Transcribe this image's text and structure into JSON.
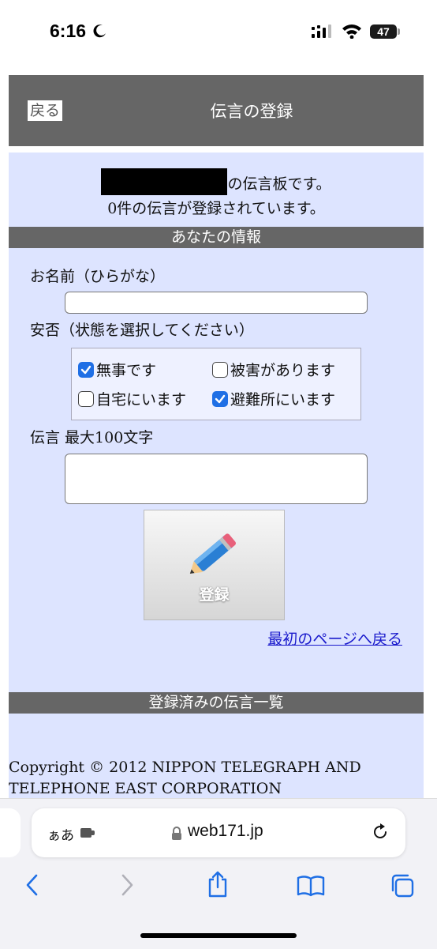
{
  "status": {
    "time": "6:16",
    "battery": "47"
  },
  "header": {
    "back_label": "戻る",
    "title": "伝言の登録"
  },
  "board": {
    "line1": "の伝言板です。",
    "line2": "0件の伝言が登録されています。"
  },
  "sections": {
    "your_info": "あなたの情報",
    "registered_list": "登録済みの伝言一覧"
  },
  "form": {
    "name_label": "お名前（ひらがな）",
    "name_value": "",
    "status_label": "安否（状態を選択してください）",
    "options": [
      {
        "label": "無事です",
        "checked": true
      },
      {
        "label": "被害があります",
        "checked": false
      },
      {
        "label": "自宅にいます",
        "checked": false
      },
      {
        "label": "避難所にいます",
        "checked": true
      }
    ],
    "message_label": "伝言 最大100文字",
    "message_value": "",
    "register_label": "登録",
    "return_link": "最初のページへ戻る"
  },
  "footer": {
    "copyright_line1": "Copyright © 2012 NIPPON TELEGRAPH AND",
    "copyright_line2": "TELEPHONE EAST CORPORATION"
  },
  "browser": {
    "text_size_label": "ぁあ",
    "url": "web171.jp",
    "accent": "#1f6fe5",
    "nav_icons": [
      "back-chevron-icon",
      "forward-chevron-icon",
      "share-icon",
      "bookmarks-icon",
      "tabs-icon"
    ]
  }
}
